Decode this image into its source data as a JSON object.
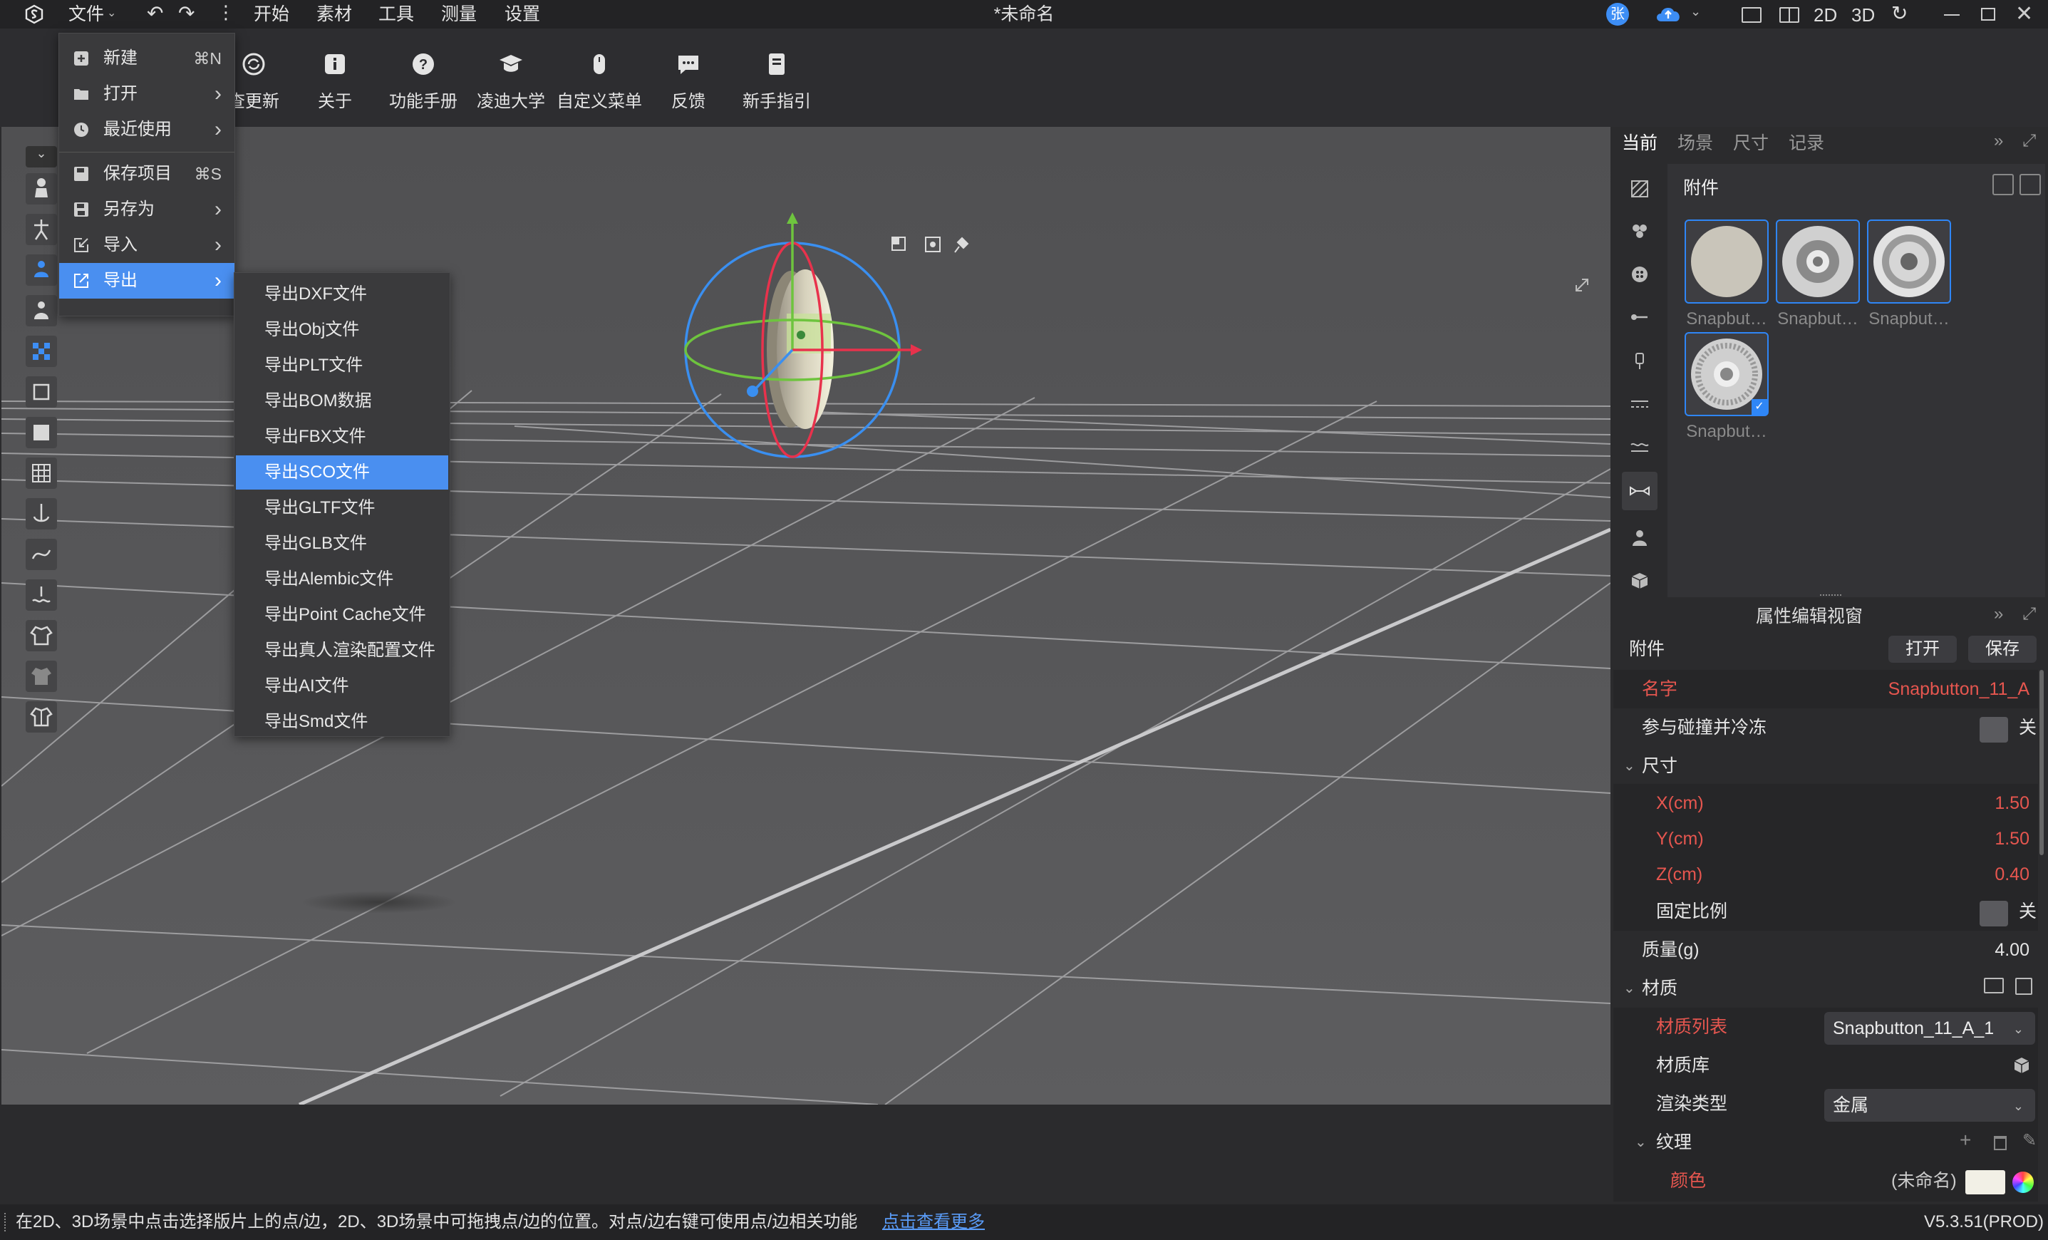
{
  "titlebar": {
    "menus": [
      "文件",
      "开始",
      "素材",
      "工具",
      "测量",
      "设置"
    ],
    "title": "*未命名",
    "user_initial": "张",
    "view_2d": "2D",
    "view_3d": "3D"
  },
  "toolbar": {
    "buttons": [
      {
        "label": "查更新",
        "icon": "refresh-icon"
      },
      {
        "label": "关于",
        "icon": "info-icon"
      },
      {
        "label": "功能手册",
        "icon": "help-icon"
      },
      {
        "label": "凌迪大学",
        "icon": "graduation-cap-icon"
      },
      {
        "label": "自定义菜单",
        "icon": "mouse-icon"
      },
      {
        "label": "反馈",
        "icon": "feedback-icon"
      },
      {
        "label": "新手指引",
        "icon": "guide-book-icon"
      }
    ]
  },
  "file_menu": {
    "items": [
      {
        "label": "新建",
        "shortcut": "⌘N",
        "icon": "new-file-icon"
      },
      {
        "label": "打开",
        "shortcut": "›",
        "icon": "folder-open-icon"
      },
      {
        "label": "最近使用",
        "shortcut": "›",
        "icon": "clock-icon"
      },
      {
        "label": "保存项目",
        "shortcut": "⌘S",
        "icon": "save-icon"
      },
      {
        "label": "另存为",
        "shortcut": "›",
        "icon": "save-as-icon"
      },
      {
        "label": "导入",
        "shortcut": "›",
        "icon": "import-icon"
      },
      {
        "label": "导出",
        "shortcut": "›",
        "icon": "export-icon"
      }
    ],
    "active_item": "导出"
  },
  "export_menu": {
    "items": [
      "导出DXF文件",
      "导出Obj文件",
      "导出PLT文件",
      "导出BOM数据",
      "导出FBX文件",
      "导出SCO文件",
      "导出GLTF文件",
      "导出GLB文件",
      "导出Alembic文件",
      "导出Point Cache文件",
      "导出真人渲染配置文件",
      "导出AI文件",
      "导出Smd文件"
    ],
    "highlighted": "导出SCO文件"
  },
  "right_panel": {
    "tabs": [
      "当前",
      "场景",
      "尺寸",
      "记录"
    ],
    "active_tab": "当前",
    "library_title": "附件",
    "thumbnails": [
      "Snapbut…",
      "Snapbut…",
      "Snapbut…",
      "Snapbut…"
    ]
  },
  "property_panel": {
    "title": "属性编辑视窗",
    "section": "附件",
    "open_label": "打开",
    "save_label": "保存",
    "name_label": "名字",
    "name_value": "Snapbutton_11_A",
    "collision_label": "参与碰撞并冷冻",
    "collision_value": "关",
    "size_label": "尺寸",
    "x_label": "X(cm)",
    "x_value": "1.50",
    "y_label": "Y(cm)",
    "y_value": "1.50",
    "z_label": "Z(cm)",
    "z_value": "0.40",
    "ratio_label": "固定比例",
    "ratio_value": "关",
    "mass_label": "质量(g)",
    "mass_value": "4.00",
    "material_label": "材质",
    "material_list_label": "材质列表",
    "material_list_value": "Snapbutton_11_A_1",
    "material_lib_label": "材质库",
    "render_type_label": "渲染类型",
    "render_type_value": "金属",
    "texture_label": "纹理",
    "color_label": "颜色",
    "color_value": "(未命名)"
  },
  "statusbar": {
    "hint": "在2D、3D场景中点击选择版片上的点/边，2D、3D场景中可拖拽点/边的位置。对点/边右键可使用点/边相关功能",
    "link": "点击查看更多",
    "version": "V5.3.51(PROD)"
  },
  "colors": {
    "accent": "#3d8ef5",
    "highlight": "#4a8ff0",
    "label_red": "#e6564f",
    "viewport_bg": "#5c5c5e"
  }
}
